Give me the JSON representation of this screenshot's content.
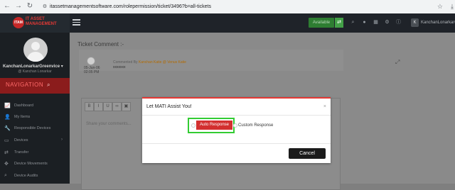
{
  "browser": {
    "url": "itassetmanagementsoftware.com/rolepermission/ticket/3496?b=all-tickets"
  },
  "header": {
    "logo_line1": "IT ASSET",
    "logo_line2": "MANAGEMENT",
    "logo_mark": "ITAM",
    "available_label": "Available",
    "user_initial": "K",
    "user_name": "KanchanLonarkarGr"
  },
  "sidebar": {
    "profile_name": "KanchanLonarkarGreenvice",
    "profile_role": "@ Kanchan Lonarkar",
    "nav_title": "NAVIGATION",
    "items": [
      {
        "label": "Dashboard",
        "icon": "chart-icon"
      },
      {
        "label": "My Items",
        "icon": "user-icon"
      },
      {
        "label": "Responsible Devices",
        "icon": "wrench-icon"
      },
      {
        "label": "Devices",
        "icon": "monitor-icon",
        "has_caret": true
      },
      {
        "label": "Transfer",
        "icon": "transfer-icon"
      },
      {
        "label": "Device Movements",
        "icon": "move-icon"
      },
      {
        "label": "Device Audits",
        "icon": "search-icon"
      }
    ]
  },
  "main": {
    "ticket_title": "Ticket Comment :-",
    "comment": {
      "date": "05-Jun-06",
      "time": "02:05 PM",
      "meta_prefix": "Commented By",
      "meta_link": "Kanchan Katie @ Venus Katie",
      "text": "xxxxxxx"
    },
    "editor_placeholder": "Share your comments..."
  },
  "modal": {
    "title": "Let MATI Assist You!",
    "close_symbol": "×",
    "auto_response_label": "Auto Response",
    "custom_response_label": "Custom Response",
    "cancel_label": "Cancel"
  },
  "colors": {
    "accent_red": "#d32f2f",
    "highlight_green": "#33cc33",
    "header_bg": "#1f2329",
    "available_green": "#2e7d32"
  }
}
